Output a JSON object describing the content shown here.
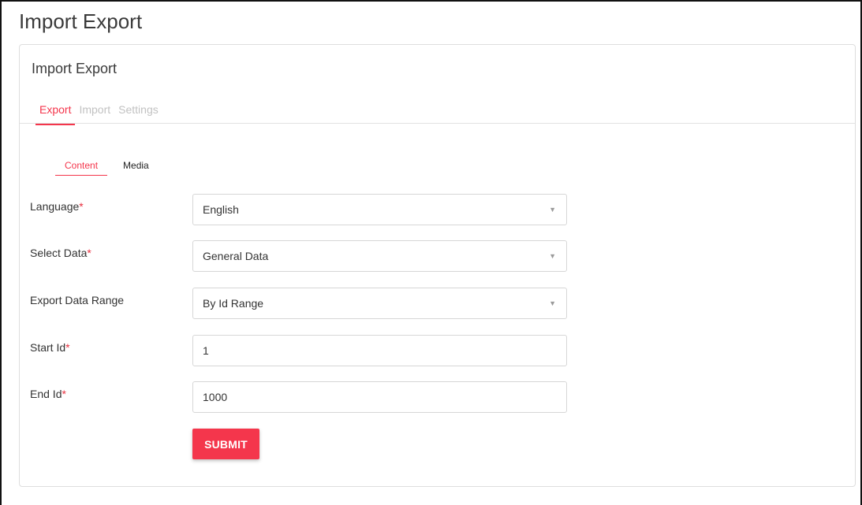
{
  "page": {
    "title": "Import Export"
  },
  "card": {
    "title": "Import Export",
    "tabs": [
      {
        "label": "Export",
        "active": true
      },
      {
        "label": "Import",
        "active": false
      },
      {
        "label": "Settings",
        "active": false
      }
    ],
    "sub_tabs": [
      {
        "label": "Content",
        "active": true
      },
      {
        "label": "Media",
        "active": false
      }
    ]
  },
  "form": {
    "language": {
      "label": "Language",
      "required": "*",
      "value": "English"
    },
    "select_data": {
      "label": "Select Data",
      "required": "*",
      "value": "General Data"
    },
    "export_range": {
      "label": "Export Data Range",
      "value": "By Id Range"
    },
    "start_id": {
      "label": "Start Id",
      "required": "*",
      "value": "1"
    },
    "end_id": {
      "label": "End Id",
      "required": "*",
      "value": "1000"
    },
    "submit_label": "SUBMIT"
  },
  "colors": {
    "accent": "#f4364c",
    "inactive_tab": "#c2c2c2",
    "border": "#d6d6d6"
  },
  "icons": {
    "dropdown": "caret-down-icon"
  }
}
